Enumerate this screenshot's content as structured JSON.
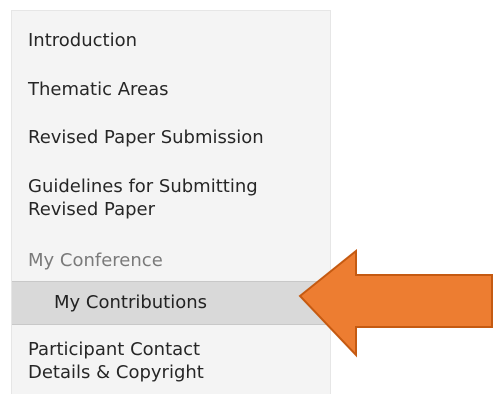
{
  "nav": {
    "items": [
      {
        "label": "Introduction"
      },
      {
        "label": "Thematic Areas"
      },
      {
        "label": "Revised Paper Submission"
      },
      {
        "label_line1": "Guidelines for Submitting",
        "label_line2": "Revised Paper"
      },
      {
        "label": "My Conference"
      },
      {
        "label": "My Contributions"
      },
      {
        "label_line1": "Participant Contact",
        "label_line2": "Details & Copyright"
      }
    ]
  },
  "annotation": {
    "arrow_color": "#ed7d31",
    "arrow_border_color": "#c55a11",
    "icon": "arrow-left-icon"
  },
  "colors": {
    "menu_background": "#f4f4f4",
    "active_background": "#d9d9d9",
    "section_text": "#7a7a7a"
  }
}
